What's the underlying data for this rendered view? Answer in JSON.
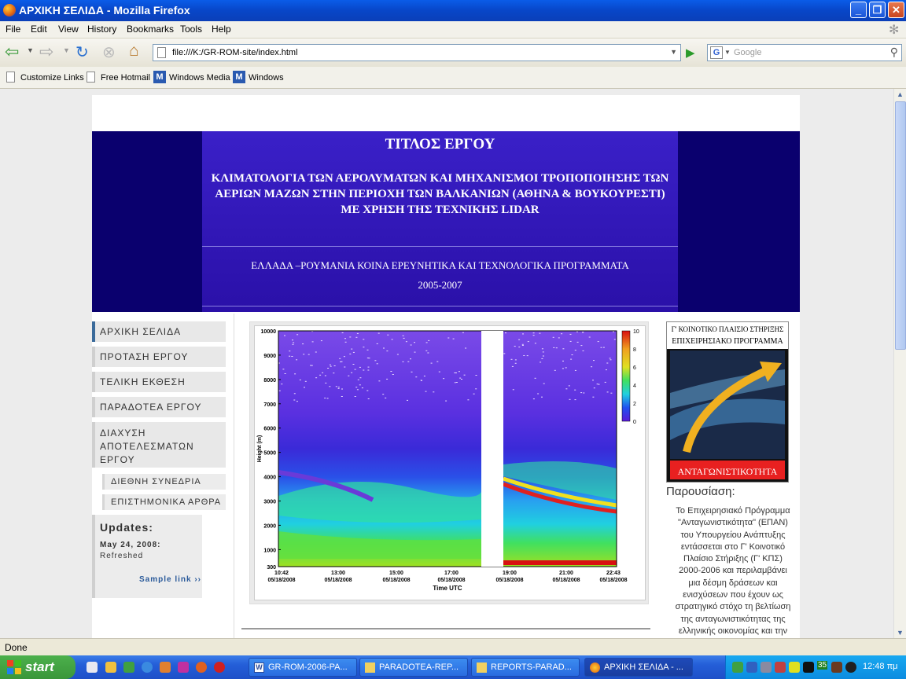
{
  "window": {
    "title": "ΑΡΧΙΚΗ ΣΕΛΙΔΑ - Mozilla Firefox",
    "min": "_",
    "max": "❐",
    "close": "✕"
  },
  "menu": [
    "File",
    "Edit",
    "View",
    "History",
    "Bookmarks",
    "Tools",
    "Help"
  ],
  "nav": {
    "url": "file:///K:/GR-ROM-site/index.html",
    "search_placeholder": "Google"
  },
  "bookmarks": [
    "Customize Links",
    "Free Hotmail",
    "Windows Media",
    "Windows"
  ],
  "banner": {
    "title": "ΤΙΤΛΟΣ ΕΡΓΟΥ",
    "subtitle": "ΚΛΙΜΑΤΟΛΟΓΙΑ ΤΩΝ ΑΕΡΟΛΥΜΑΤΩΝ ΚΑΙ ΜΗΧΑΝΙΣΜΟΙ ΤΡΟΠΟΠΟΙΗΣΗΣ ΤΩΝ ΑΕΡΙΩΝ ΜΑΖΩΝ ΣΤΗΝ ΠΕΡΙΟΧΗ ΤΩΝ ΒΑΛΚΑΝΙΩΝ (ΑΘΗΝΑ & ΒΟΥΚΟΥΡΕΣΤΙ) ΜΕ ΧΡΗΣΗ ΤΗΣ ΤΕΧΝΙΚΗΣ LIDAR",
    "program": "ΕΛΛΑΔΑ –ΡΟΥΜΑΝΙΑ ΚΟΙΝΑ ΕΡΕΥΝΗΤΙΚΑ ΚΑΙ ΤΕΧΝΟΛΟΓΙΚΑ ΠΡΟΓΡΑΜΜΑΤΑ",
    "years": "2005-2007"
  },
  "sidebar": {
    "items": [
      "ΑΡΧΙΚΗ ΣΕΛΙΔΑ",
      "ΠΡΟΤΑΣΗ ΕΡΓΟΥ",
      "ΤΕΛΙΚΗ ΕΚΘΕΣΗ",
      "ΠΑΡΑΔΟΤΕΑ ΕΡΓΟΥ",
      "ΔΙΑΧΥΣΗ ΑΠΟΤΕΛΕΣΜΑΤΩΝ ΕΡΓΟΥ"
    ],
    "subitems": [
      "ΔΙΕΘΝΗ ΣΥΝΕΔΡΙΑ",
      "ΕΠΙΣΤΗΜΟΝΙΚΑ ΑΡΘΡΑ"
    ]
  },
  "updates": {
    "title": "Updates:",
    "date": "May 24, 2008:",
    "text": "Refreshed",
    "link": "Sample link ››"
  },
  "chart_data": {
    "type": "heatmap",
    "title": "",
    "xlabel": "Time UTC",
    "ylabel": "Height (m)",
    "yticks": [
      "10000",
      "9000",
      "8000",
      "7000",
      "6000",
      "5000",
      "4000",
      "3000",
      "2000",
      "1000",
      "300"
    ],
    "ylim": [
      300,
      10000
    ],
    "xticks": [
      {
        "time": "10:42",
        "date": "05/18/2008"
      },
      {
        "time": "13:00",
        "date": "05/18/2008"
      },
      {
        "time": "15:00",
        "date": "05/18/2008"
      },
      {
        "time": "17:00",
        "date": "05/18/2008"
      },
      {
        "time": "19:00",
        "date": "05/18/2008"
      },
      {
        "time": "21:00",
        "date": "05/18/2008"
      },
      {
        "time": "22:43",
        "date": "05/18/2008"
      }
    ],
    "colorbar": {
      "ticks": [
        "10",
        "8",
        "6",
        "4",
        "2",
        "0"
      ],
      "range": [
        0,
        10
      ]
    },
    "colors": {
      "low": "#3a1ad8",
      "mid": "#20c8f0",
      "high": "#d81010"
    }
  },
  "epan": {
    "top1": "Γ' ΚΟΙΝΟΤΙΚΟ ΠΛΑΙΣΙΟ ΣΤΗΡΙΞΗΣ",
    "top2": "ΕΠΙΧΕΙΡΗΣΙΑΚΟ ΠΡΟΓΡΑΜΜΑ",
    "bottom": "ΑΝΤΑΓΩΝΙΣΤΙΚΟΤΗΤΑ"
  },
  "presentation": {
    "title": "Παρουσίαση:",
    "lines": [
      "Το Επιχειρησιακό Πρόγραμμα",
      "\"Ανταγωνιστικότητα\" (ΕΠΑΝ)",
      "του Υπουργείου Ανάπτυξης",
      "εντάσσεται στο Γ' Κοινοτικό",
      "Πλαίσιο Στήριξης (Γ' ΚΠΣ)",
      "2000-2006 και περιλαμβάνει",
      "μια δέσμη δράσεων και",
      "ενισχύσεων που έχουν ως",
      "στρατηγικό στόχο τη βελτίωση",
      "της ανταγωνιστικότητας της",
      "ελληνικής οικονομίας και την"
    ]
  },
  "status": "Done",
  "taskbar": {
    "start": "start",
    "tasks": [
      "GR-ROM-2006-PA...",
      "PARADOTEA-REP...",
      "REPORTS-PARAD...",
      "ΑΡΧΙΚΗ ΣΕΛΙΔΑ - ..."
    ],
    "clock": "12:48 πμ",
    "tray_badge": "35"
  }
}
